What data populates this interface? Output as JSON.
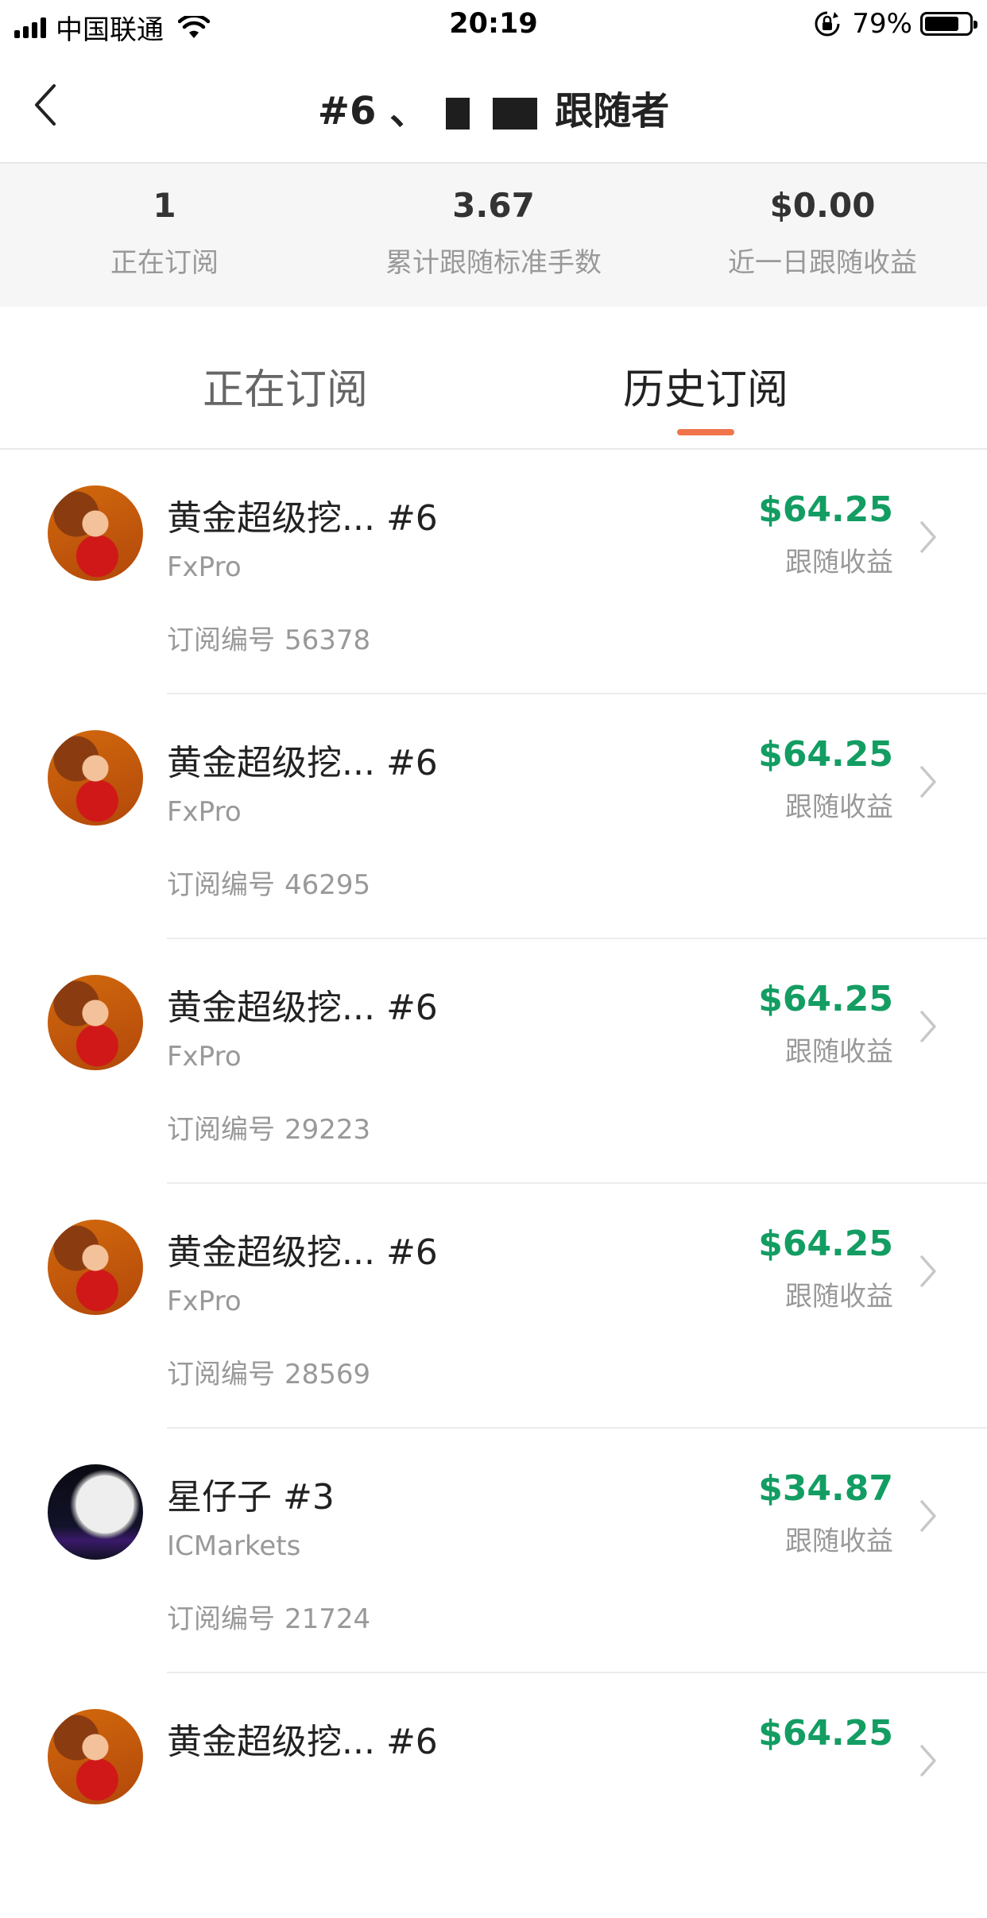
{
  "status_bar": {
    "carrier": "中国联通",
    "time": "20:19",
    "battery": "79%"
  },
  "nav": {
    "title_prefix": "#6 、",
    "title_suffix": "跟随者"
  },
  "stats": [
    {
      "value": "1",
      "label": "正在订阅"
    },
    {
      "value": "3.67",
      "label": "累计跟随标准手数"
    },
    {
      "value": "$0.00",
      "label": "近一日跟随收益"
    }
  ],
  "tabs": {
    "current": "正在订阅",
    "history": "历史订阅"
  },
  "list_labels": {
    "sub_prefix": "订阅编号",
    "profit_label": "跟随收益"
  },
  "subscriptions": [
    {
      "name": "黄金超级挖... #6",
      "broker": "FxPro",
      "sub_id": "56378",
      "profit": "$64.25",
      "avatar": "woman-red-dress"
    },
    {
      "name": "黄金超级挖... #6",
      "broker": "FxPro",
      "sub_id": "46295",
      "profit": "$64.25",
      "avatar": "woman-red-dress"
    },
    {
      "name": "黄金超级挖... #6",
      "broker": "FxPro",
      "sub_id": "29223",
      "profit": "$64.25",
      "avatar": "woman-red-dress"
    },
    {
      "name": "黄金超级挖... #6",
      "broker": "FxPro",
      "sub_id": "28569",
      "profit": "$64.25",
      "avatar": "woman-red-dress"
    },
    {
      "name": "星仔子 #3",
      "broker": "ICMarkets",
      "sub_id": "21724",
      "profit": "$34.87",
      "avatar": "moon-night"
    },
    {
      "name": "黄金超级挖... #6",
      "broker": "",
      "sub_id": "",
      "profit": "$64.25",
      "avatar": "woman-red-dress"
    }
  ],
  "colors": {
    "profit_green": "#139d63",
    "tab_indicator": "#f0754b"
  }
}
